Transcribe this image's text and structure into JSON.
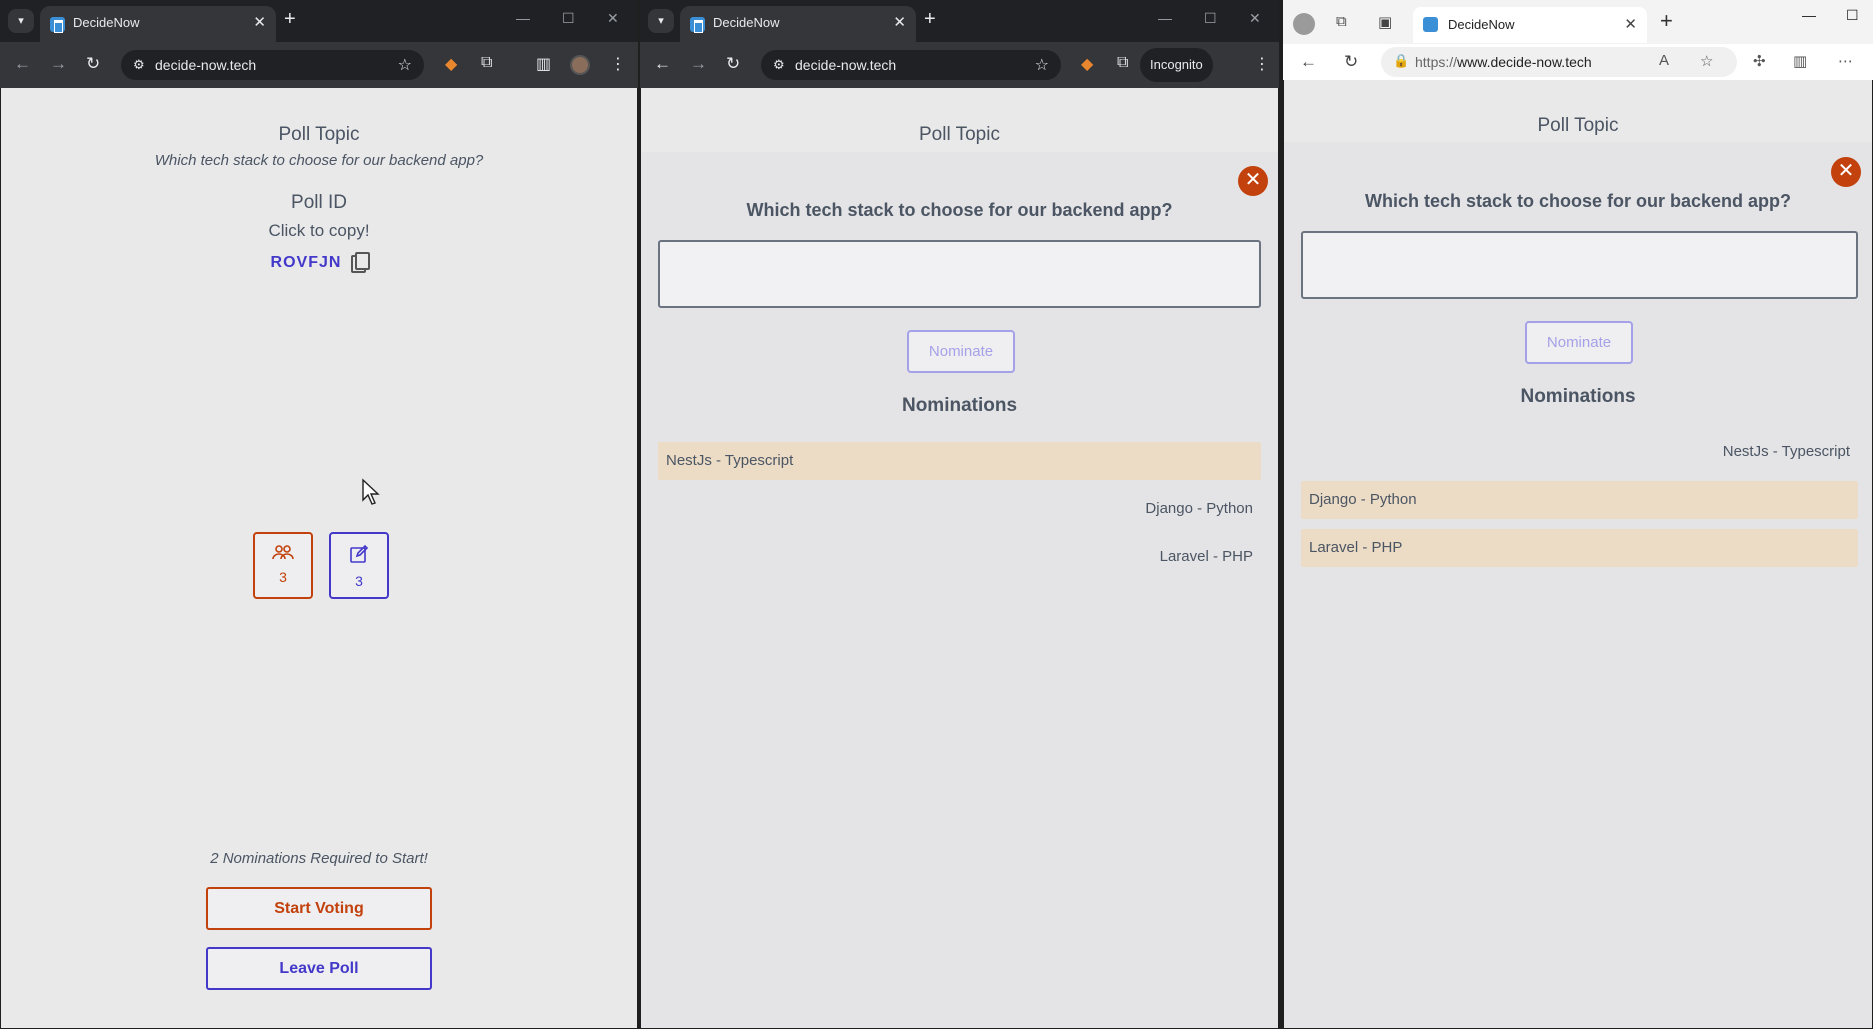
{
  "browser_tab_title": "DecideNow",
  "chrome_url": "decide-now.tech",
  "incognito_label": "Incognito",
  "edge_url_prefix": "https://",
  "edge_url_host": "www.decide-now.tech",
  "poll": {
    "topic_label": "Poll Topic",
    "topic": "Which tech stack to choose for our backend app?",
    "id_label": "Poll ID",
    "copy_hint": "Click to copy!",
    "id": "ROVFJN",
    "participants_count": "3",
    "nominations_count": "3",
    "required_text": "2 Nominations Required to Start!",
    "start_label": "Start Voting",
    "leave_label": "Leave Poll"
  },
  "nominate": {
    "question": "Which tech stack to choose for our backend app?",
    "input_value": "",
    "button_label": "Nominate",
    "close_label": "✕",
    "nominations_heading": "Nominations"
  },
  "nominations_w2": [
    {
      "text": "NestJs - Typescript",
      "own": true
    },
    {
      "text": "Django - Python",
      "own": false
    },
    {
      "text": "Laravel - PHP",
      "own": false
    }
  ],
  "nominations_w3": [
    {
      "text": "NestJs - Typescript",
      "own": false
    },
    {
      "text": "Django - Python",
      "own": true
    },
    {
      "text": "Laravel - PHP",
      "own": true
    }
  ],
  "colors": {
    "accent_orange": "#c2410c",
    "accent_indigo": "#4338ca",
    "own_nomination_bg": "#ecdcc6"
  },
  "icons": [
    "participants-icon",
    "edit-icon",
    "copy-icon",
    "close-icon"
  ]
}
